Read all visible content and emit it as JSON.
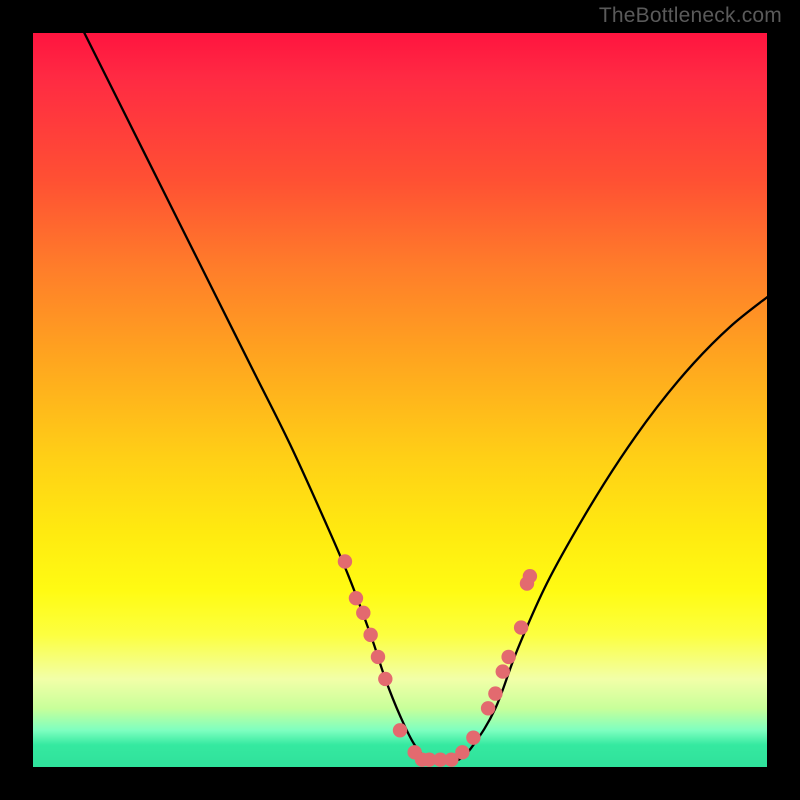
{
  "watermark": "TheBottleneck.com",
  "chart_data": {
    "type": "line",
    "title": "",
    "xlabel": "",
    "ylabel": "",
    "xlim": [
      0,
      100
    ],
    "ylim": [
      0,
      100
    ],
    "series": [
      {
        "name": "curve",
        "x": [
          7,
          10,
          15,
          20,
          25,
          30,
          35,
          40,
          43,
          46,
          48,
          50,
          52,
          54,
          56,
          58,
          60,
          63,
          66,
          70,
          75,
          80,
          85,
          90,
          95,
          100
        ],
        "y": [
          100,
          94,
          84,
          74,
          64,
          54,
          44,
          33,
          26,
          18,
          12,
          7,
          3,
          1,
          1,
          1,
          3,
          8,
          16,
          25,
          34,
          42,
          49,
          55,
          60,
          64
        ]
      }
    ],
    "markers": {
      "name": "highlight-dots",
      "color": "#e36a6f",
      "points": [
        {
          "x": 42.5,
          "y": 28
        },
        {
          "x": 44.0,
          "y": 23
        },
        {
          "x": 45.0,
          "y": 21
        },
        {
          "x": 46.0,
          "y": 18
        },
        {
          "x": 47.0,
          "y": 15
        },
        {
          "x": 48.0,
          "y": 12
        },
        {
          "x": 50.0,
          "y": 5
        },
        {
          "x": 52.0,
          "y": 2
        },
        {
          "x": 53.0,
          "y": 1
        },
        {
          "x": 54.0,
          "y": 1
        },
        {
          "x": 55.5,
          "y": 1
        },
        {
          "x": 57.0,
          "y": 1
        },
        {
          "x": 58.5,
          "y": 2
        },
        {
          "x": 60.0,
          "y": 4
        },
        {
          "x": 62.0,
          "y": 8
        },
        {
          "x": 63.0,
          "y": 10
        },
        {
          "x": 64.0,
          "y": 13
        },
        {
          "x": 64.8,
          "y": 15
        },
        {
          "x": 66.5,
          "y": 19
        },
        {
          "x": 67.3,
          "y": 25
        },
        {
          "x": 67.7,
          "y": 26
        }
      ]
    },
    "gradient_stops": [
      {
        "pos": 0.0,
        "color": "#ff143f"
      },
      {
        "pos": 0.2,
        "color": "#ff5033"
      },
      {
        "pos": 0.44,
        "color": "#ffa41f"
      },
      {
        "pos": 0.68,
        "color": "#ffea10"
      },
      {
        "pos": 0.88,
        "color": "#f2ffa8"
      },
      {
        "pos": 0.97,
        "color": "#35e9a0"
      },
      {
        "pos": 1.0,
        "color": "#2fe19b"
      }
    ]
  }
}
